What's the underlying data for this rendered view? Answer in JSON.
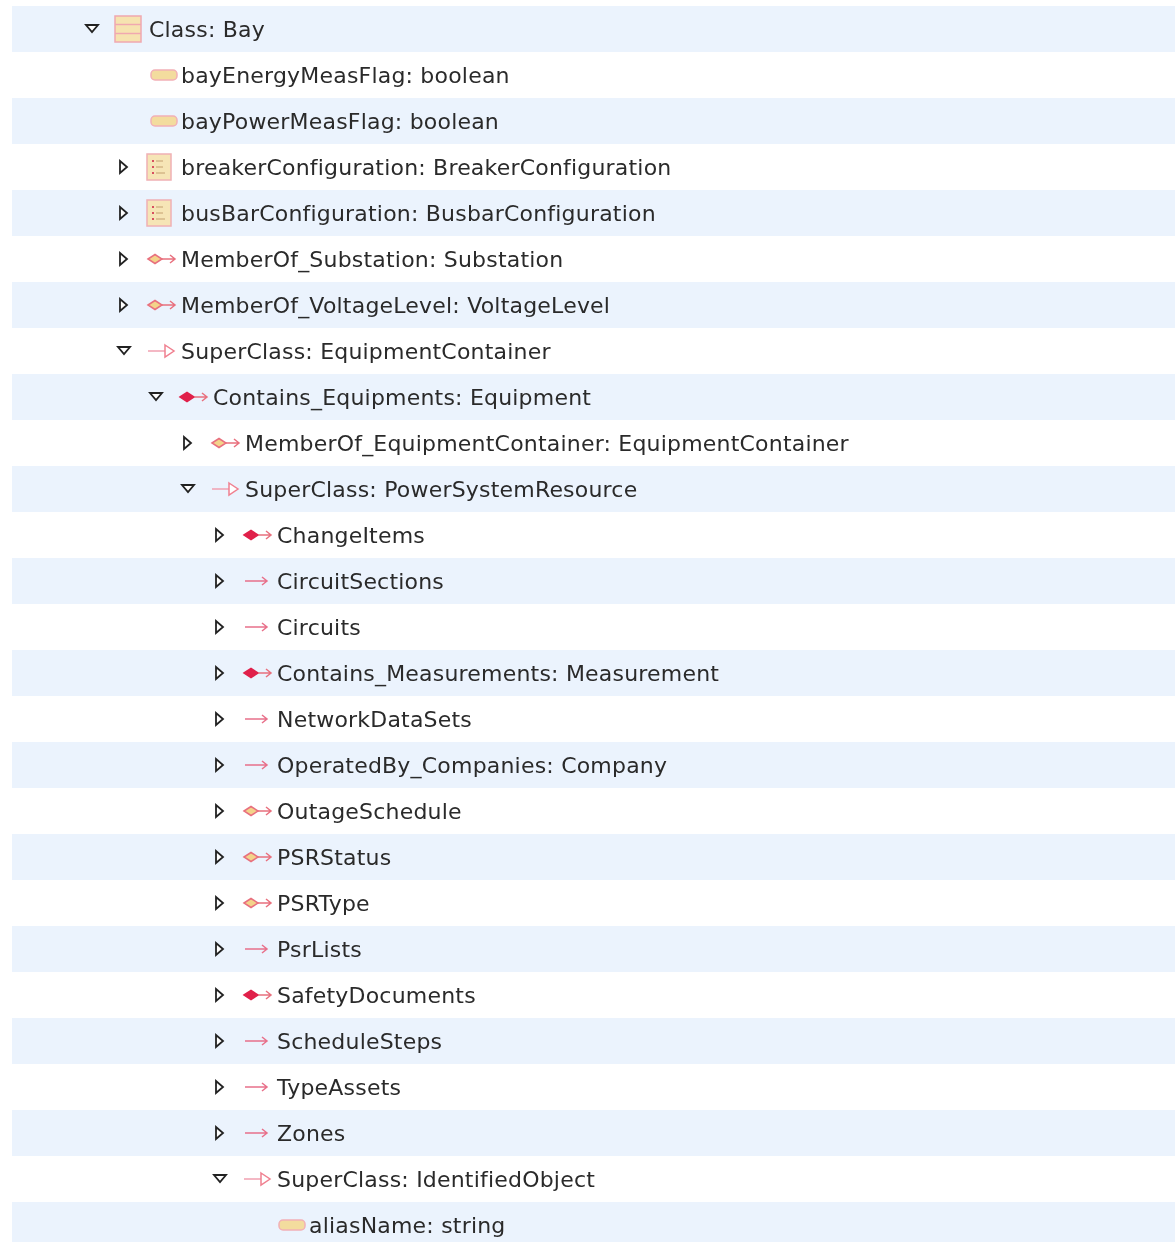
{
  "tree": [
    {
      "kind": "class",
      "label": "Class: Bay",
      "expanded": true,
      "children": [
        {
          "kind": "attribute",
          "label": "bayEnergyMeasFlag: boolean"
        },
        {
          "kind": "attribute",
          "label": "bayPowerMeasFlag: boolean"
        },
        {
          "kind": "enum",
          "label": "breakerConfiguration: BreakerConfiguration",
          "expanded": false
        },
        {
          "kind": "enum",
          "label": "busBarConfiguration: BusbarConfiguration",
          "expanded": false
        },
        {
          "kind": "aggregation",
          "label": "MemberOf_Substation: Substation",
          "expanded": false
        },
        {
          "kind": "aggregation",
          "label": "MemberOf_VoltageLevel: VoltageLevel",
          "expanded": false
        },
        {
          "kind": "superclass",
          "label": "SuperClass: EquipmentContainer",
          "expanded": true,
          "children": [
            {
              "kind": "composition",
              "label": "Contains_Equipments: Equipment",
              "expanded": true,
              "children": [
                {
                  "kind": "aggregation",
                  "label": "MemberOf_EquipmentContainer: EquipmentContainer",
                  "expanded": false
                },
                {
                  "kind": "superclass",
                  "label": "SuperClass: PowerSystemResource",
                  "expanded": true,
                  "children": [
                    {
                      "kind": "composition",
                      "label": "ChangeItems",
                      "expanded": false
                    },
                    {
                      "kind": "association",
                      "label": "CircuitSections",
                      "expanded": false
                    },
                    {
                      "kind": "association",
                      "label": "Circuits",
                      "expanded": false
                    },
                    {
                      "kind": "composition",
                      "label": "Contains_Measurements: Measurement",
                      "expanded": false
                    },
                    {
                      "kind": "association",
                      "label": "NetworkDataSets",
                      "expanded": false
                    },
                    {
                      "kind": "association",
                      "label": "OperatedBy_Companies: Company",
                      "expanded": false
                    },
                    {
                      "kind": "aggregation",
                      "label": "OutageSchedule",
                      "expanded": false
                    },
                    {
                      "kind": "aggregation",
                      "label": "PSRStatus",
                      "expanded": false
                    },
                    {
                      "kind": "aggregation",
                      "label": "PSRType",
                      "expanded": false
                    },
                    {
                      "kind": "association",
                      "label": "PsrLists",
                      "expanded": false
                    },
                    {
                      "kind": "composition",
                      "label": "SafetyDocuments",
                      "expanded": false
                    },
                    {
                      "kind": "association",
                      "label": "ScheduleSteps",
                      "expanded": false
                    },
                    {
                      "kind": "association",
                      "label": "TypeAssets",
                      "expanded": false
                    },
                    {
                      "kind": "association",
                      "label": "Zones",
                      "expanded": false
                    },
                    {
                      "kind": "superclass",
                      "label": "SuperClass: IdentifiedObject",
                      "expanded": true,
                      "children": [
                        {
                          "kind": "attribute",
                          "label": "aliasName: string"
                        }
                      ]
                    }
                  ]
                }
              ]
            }
          ]
        }
      ]
    }
  ]
}
